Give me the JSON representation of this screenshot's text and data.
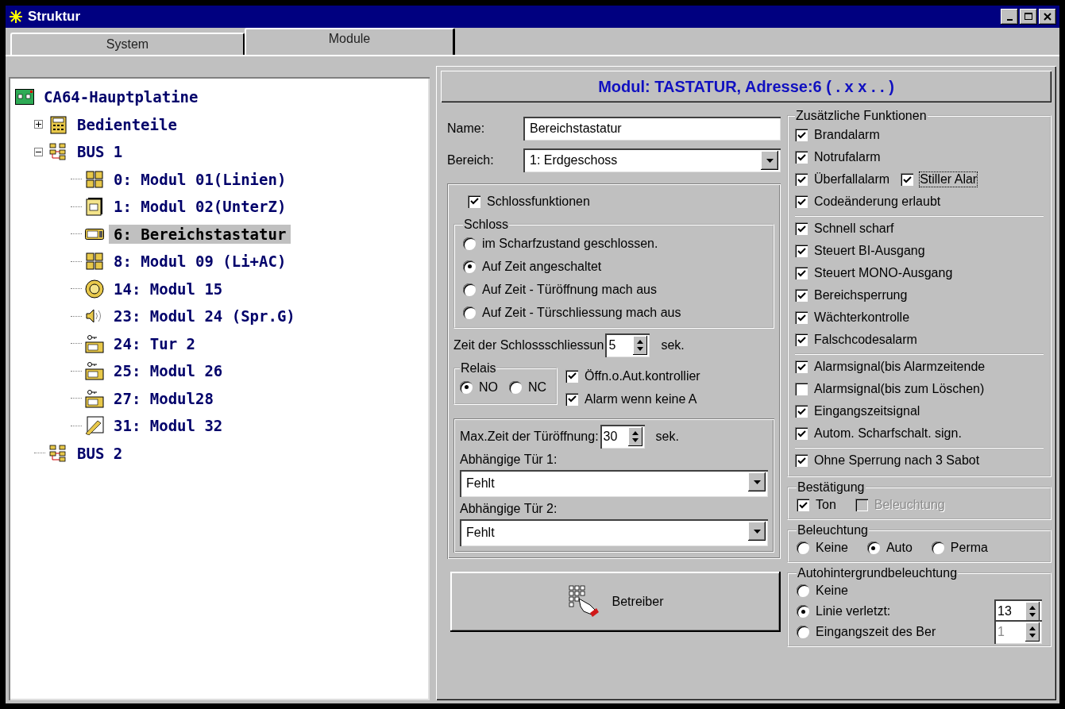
{
  "window": {
    "title": "Struktur"
  },
  "tabs": [
    {
      "label": "System",
      "selected": false
    },
    {
      "label": "Module",
      "selected": true
    }
  ],
  "tree": [
    {
      "label": "CA64-Hauptplatine",
      "kind": "board",
      "selected": false,
      "children": [
        {
          "label": "Bedienteile",
          "kind": "keypad",
          "selected": false,
          "expanded": false
        },
        {
          "label": "BUS 1",
          "kind": "bus",
          "selected": false,
          "expanded": true,
          "children": [
            {
              "label": "0: Modul 01(Linien)",
              "kind": "zones",
              "selected": false
            },
            {
              "label": "1: Modul 02(UnterZ)",
              "kind": "chip",
              "selected": false
            },
            {
              "label": "6: Bereichstastatur",
              "kind": "keyboard",
              "selected": true
            },
            {
              "label": "8: Modul 09 (Li+AC)",
              "kind": "zones",
              "selected": false
            },
            {
              "label": "14: Modul 15",
              "kind": "disc",
              "selected": false
            },
            {
              "label": "23: Modul 24 (Spr.G)",
              "kind": "speaker",
              "selected": false
            },
            {
              "label": "24: Tur 2",
              "kind": "door",
              "selected": false
            },
            {
              "label": "25: Modul 26",
              "kind": "door",
              "selected": false
            },
            {
              "label": "27: Modul28",
              "kind": "door",
              "selected": false
            },
            {
              "label": "31: Modul 32",
              "kind": "card",
              "selected": false
            }
          ]
        },
        {
          "label": "BUS 2",
          "kind": "bus",
          "selected": false
        }
      ]
    }
  ],
  "module_header": "Modul: TASTATUR, Adresse:6 ( . x x . . )",
  "general": {
    "name_label": "Name:",
    "name_value": "Bereichstastatur",
    "area_label": "Bereich:",
    "area_value": "1: Erdgeschoss"
  },
  "lock": {
    "enabled_label": "Schlossfunktionen",
    "enabled": true,
    "group_title": "Schloss",
    "options": [
      {
        "label": "im Scharfzustand geschlossen.",
        "selected": false
      },
      {
        "label": "Auf Zeit angeschaltet",
        "selected": true
      },
      {
        "label": "Auf Zeit - Türöffnung mach aus",
        "selected": false
      },
      {
        "label": "Auf Zeit - Türschliessung mach aus",
        "selected": false
      }
    ],
    "close_time_label": "Zeit der Schlossschliessun",
    "close_time_value": "5",
    "close_time_unit": "sek.",
    "relay": {
      "title": "Relais",
      "options": [
        {
          "label": "NO",
          "selected": true
        },
        {
          "label": "NC",
          "selected": false
        }
      ]
    },
    "checks": [
      {
        "label": "Öffn.o.Aut.kontrollier",
        "checked": true
      },
      {
        "label": "Alarm wenn keine A",
        "checked": true
      }
    ]
  },
  "door": {
    "max_time_label": "Max.Zeit der Türöffnung:",
    "max_time_value": "30",
    "max_time_unit": "sek.",
    "dependents": [
      {
        "label": "Abhängige Tür 1:",
        "value": "Fehlt"
      },
      {
        "label": "Abhängige Tür 2:",
        "value": "Fehlt"
      }
    ]
  },
  "operator_button": "Betreiber",
  "functions": {
    "title": "Zusätzliche Funktionen",
    "groups": [
      [
        {
          "label": "Brandalarm",
          "checked": true
        },
        {
          "label": "Notrufalarm",
          "checked": true
        },
        {
          "label": "Überfallalarm",
          "checked": true,
          "extra": {
            "label": "Stiller Alar",
            "checked": true,
            "focused": true
          }
        },
        {
          "label": "Codeänderung erlaubt",
          "checked": true
        }
      ],
      [
        {
          "label": "Schnell scharf",
          "checked": true
        },
        {
          "label": "Steuert BI-Ausgang",
          "checked": true
        },
        {
          "label": "Steuert MONO-Ausgang",
          "checked": true
        },
        {
          "label": "Bereichsperrung",
          "checked": true
        },
        {
          "label": "Wächterkontrolle",
          "checked": true
        },
        {
          "label": "Falschcodesalarm",
          "checked": true
        }
      ],
      [
        {
          "label": "Alarmsignal(bis Alarmzeitende",
          "checked": true
        },
        {
          "label": "Alarmsignal(bis zum Löschen)",
          "checked": false
        },
        {
          "label": "Eingangszeitsignal",
          "checked": true
        },
        {
          "label": "Autom. Scharfschalt. sign.",
          "checked": true
        }
      ],
      [
        {
          "label": "Ohne Sperrung nach 3 Sabot",
          "checked": true
        }
      ]
    ]
  },
  "confirmation": {
    "title": "Bestätigung",
    "options": [
      {
        "label": "Ton",
        "checked": true,
        "disabled": false
      },
      {
        "label": "Beleuchtung",
        "checked": false,
        "disabled": true
      }
    ]
  },
  "backlight": {
    "title": "Beleuchtung",
    "options": [
      {
        "label": "Keine",
        "selected": false
      },
      {
        "label": "Auto",
        "selected": true
      },
      {
        "label": "Perma",
        "selected": false
      }
    ]
  },
  "auto_backlight": {
    "title": "Autohintergrundbeleuchtung",
    "options": [
      {
        "label": "Keine",
        "selected": false
      },
      {
        "label": "Linie verletzt:",
        "selected": true,
        "spin": "13",
        "spin_disabled": false
      },
      {
        "label": "Eingangszeit des Ber",
        "selected": false,
        "spin": "1",
        "spin_disabled": true
      }
    ]
  }
}
